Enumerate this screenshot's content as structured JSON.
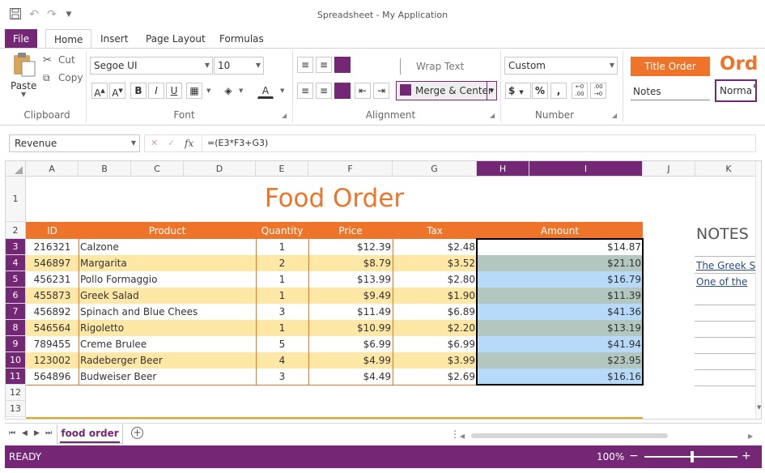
{
  "app": {
    "title": "Spreadsheet - My Application"
  },
  "tabs": [
    "File",
    "Home",
    "Insert",
    "Page Layout",
    "Formulas"
  ],
  "ribbon": {
    "clipboard": {
      "paste": "Paste",
      "cut": "Cut",
      "copy": "Copy",
      "label": "Clipboard"
    },
    "font": {
      "family": "Segoe UI",
      "size": "10",
      "bold": "B",
      "italic": "I",
      "underline": "U",
      "label": "Font"
    },
    "alignment": {
      "wrap": "Wrap Text",
      "merge": "Merge & Center",
      "label": "Alignment"
    },
    "number": {
      "format": "Custom",
      "currency": "$",
      "percent": "%",
      "comma": ",",
      "label": "Number"
    },
    "styles": {
      "title_order": "Title Order",
      "ord": "Ord",
      "notes": "Notes",
      "normal": "Norma"
    }
  },
  "formula_bar": {
    "name_box": "Revenue",
    "fx": "fx",
    "formula": "=(E3*F3+G3)"
  },
  "sheet": {
    "columns": [
      "A",
      "B",
      "C",
      "D",
      "E",
      "F",
      "G",
      "H",
      "I",
      "J",
      "K"
    ],
    "title": "Food Order",
    "headers": [
      "ID",
      "Product",
      "Quantity",
      "Price",
      "Tax",
      "Amount"
    ],
    "rows": [
      [
        "216321",
        "Calzone",
        "1",
        "$12.39",
        "$2.48",
        "$14.87"
      ],
      [
        "546897",
        "Margarita",
        "2",
        "$8.79",
        "$3.52",
        "$21.10"
      ],
      [
        "456231",
        "Pollo Formaggio",
        "1",
        "$13.99",
        "$2.80",
        "$16.79"
      ],
      [
        "455873",
        "Greek Salad",
        "1",
        "$9.49",
        "$1.90",
        "$11.39"
      ],
      [
        "456892",
        "Spinach and Blue Chees",
        "3",
        "$11.49",
        "$6.89",
        "$41.36"
      ],
      [
        "546564",
        "Rigoletto",
        "1",
        "$10.99",
        "$2.20",
        "$13.19"
      ],
      [
        "789455",
        "Creme Brulee",
        "5",
        "$6.99",
        "$6.99",
        "$41.94"
      ],
      [
        "123002",
        "Radeberger Beer",
        "4",
        "$4.99",
        "$3.99",
        "$23.95"
      ],
      [
        "564896",
        "Budweiser Beer",
        "3",
        "$4.49",
        "$2.69",
        "$16.16"
      ]
    ],
    "notes": {
      "title": "NOTES",
      "lines": [
        "The Greek S",
        "One of the"
      ]
    }
  },
  "sheet_tabs": {
    "active": "food order"
  },
  "status": {
    "mode": "READY",
    "zoom": "100%",
    "minus": "−",
    "plus": "+"
  },
  "colors": {
    "accent": "#742774",
    "orange": "#ED7428",
    "band": "#FFE7A6",
    "amount_a": "#B4C6C0",
    "amount_b": "#B7D9FA",
    "gold_bar": "#E0A81A"
  }
}
